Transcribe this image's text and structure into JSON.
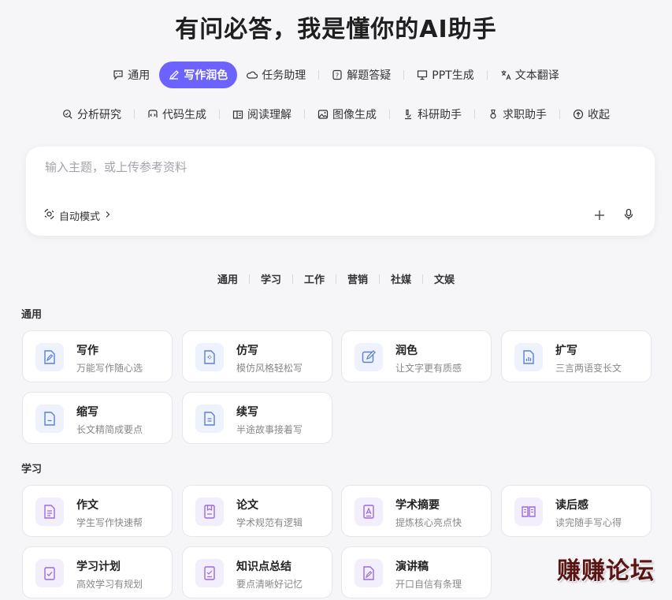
{
  "title": "有问必答，我是懂你的AI助手",
  "tabs_row1": [
    {
      "label": "通用",
      "icon": "chat-icon",
      "active": false
    },
    {
      "label": "写作润色",
      "icon": "pen-icon",
      "active": true
    },
    {
      "label": "任务助理",
      "icon": "cloud-icon",
      "active": false
    },
    {
      "label": "解题答疑",
      "icon": "question-icon",
      "active": false
    },
    {
      "label": "PPT生成",
      "icon": "presentation-icon",
      "active": false
    },
    {
      "label": "文本翻译",
      "icon": "translate-icon",
      "active": false
    }
  ],
  "tabs_row2": [
    {
      "label": "分析研究",
      "icon": "search-icon"
    },
    {
      "label": "代码生成",
      "icon": "code-icon"
    },
    {
      "label": "阅读理解",
      "icon": "book-icon"
    },
    {
      "label": "图像生成",
      "icon": "image-icon"
    },
    {
      "label": "科研助手",
      "icon": "microscope-icon"
    },
    {
      "label": "求职助手",
      "icon": "medal-icon"
    },
    {
      "label": "收起",
      "icon": "collapse-icon"
    }
  ],
  "input": {
    "placeholder": "输入主题，或上传参考资料",
    "mode_label": "自动模式"
  },
  "categories": [
    "通用",
    "学习",
    "工作",
    "营销",
    "社媒",
    "文娱"
  ],
  "sections": [
    {
      "title": "通用",
      "cards": [
        {
          "title": "写作",
          "subtitle": "万能写作随心选",
          "icon": "write-doc-icon"
        },
        {
          "title": "仿写",
          "subtitle": "模仿风格轻松写",
          "icon": "imitate-doc-icon"
        },
        {
          "title": "润色",
          "subtitle": "让文字更有质感",
          "icon": "edit-icon"
        },
        {
          "title": "扩写",
          "subtitle": "三言两语变长文",
          "icon": "expand-doc-icon"
        },
        {
          "title": "缩写",
          "subtitle": "长文精简成要点",
          "icon": "shrink-doc-icon"
        },
        {
          "title": "续写",
          "subtitle": "半途故事接着写",
          "icon": "continue-doc-icon"
        }
      ]
    },
    {
      "title": "学习",
      "cards": [
        {
          "title": "作文",
          "subtitle": "学生写作快速帮",
          "icon": "essay-icon"
        },
        {
          "title": "论文",
          "subtitle": "学术规范有逻辑",
          "icon": "paper-icon"
        },
        {
          "title": "学术摘要",
          "subtitle": "提炼核心亮点快",
          "icon": "abstract-icon"
        },
        {
          "title": "读后感",
          "subtitle": "读完随手写心得",
          "icon": "open-book-icon"
        },
        {
          "title": "学习计划",
          "subtitle": "高效学习有规划",
          "icon": "checklist-icon"
        },
        {
          "title": "知识点总结",
          "subtitle": "要点清晰好记忆",
          "icon": "summary-icon"
        },
        {
          "title": "演讲稿",
          "subtitle": "开口自信有条理",
          "icon": "speech-icon"
        }
      ]
    }
  ],
  "watermark": "赚赚论坛",
  "colors": {
    "accent": "#6c63ff",
    "blue_icon": "#5b7fd6",
    "purple_icon": "#9b6bd8"
  }
}
